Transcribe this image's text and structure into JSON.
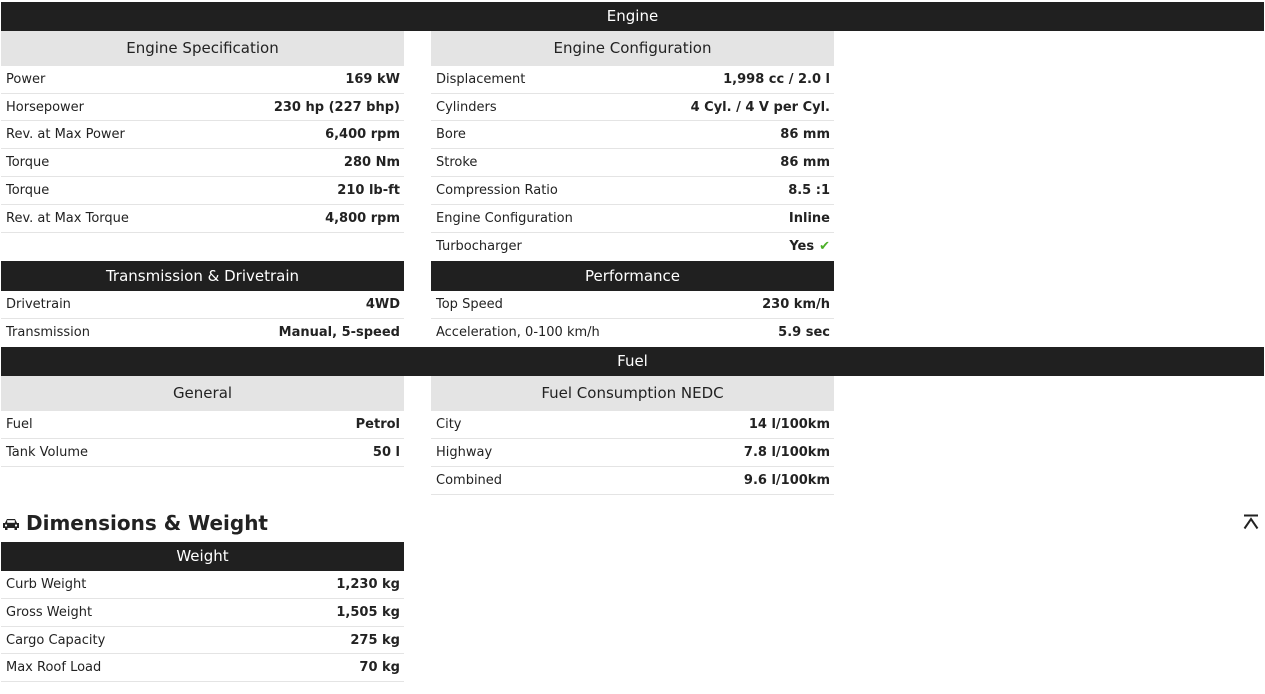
{
  "engine_band": {
    "title": "Engine"
  },
  "engine_spec": {
    "title": "Engine Specification",
    "rows": [
      {
        "label": "Power",
        "value": "169 kW"
      },
      {
        "label": "Horsepower",
        "value": "230 hp (227 bhp)"
      },
      {
        "label": "Rev. at Max Power",
        "value": "6,400 rpm"
      },
      {
        "label": "Torque",
        "value": "280 Nm"
      },
      {
        "label": "Torque",
        "value": "210 lb-ft"
      },
      {
        "label": "Rev. at Max Torque",
        "value": "4,800 rpm"
      }
    ]
  },
  "engine_config": {
    "title": "Engine Configuration",
    "rows": [
      {
        "label": "Displacement",
        "value": "1,998 cc / 2.0 l"
      },
      {
        "label": "Cylinders",
        "value": "4 Cyl. / 4 V per Cyl."
      },
      {
        "label": "Bore",
        "value": "86 mm"
      },
      {
        "label": "Stroke",
        "value": "86 mm"
      },
      {
        "label": "Compression Ratio",
        "value": "8.5 :1"
      },
      {
        "label": "Engine Configuration",
        "value": "Inline"
      },
      {
        "label": "Turbocharger",
        "value": "Yes",
        "icon": "checkmark-icon"
      }
    ]
  },
  "transmission": {
    "title": "Transmission & Drivetrain",
    "rows": [
      {
        "label": "Drivetrain",
        "value": "4WD"
      },
      {
        "label": "Transmission",
        "value": "Manual, 5-speed"
      }
    ]
  },
  "performance": {
    "title": "Performance",
    "rows": [
      {
        "label": "Top Speed",
        "value": "230 km/h"
      },
      {
        "label": "Acceleration, 0-100 km/h",
        "value": "5.9 sec"
      }
    ]
  },
  "fuel_band": {
    "title": "Fuel"
  },
  "general": {
    "title": "General",
    "rows": [
      {
        "label": "Fuel",
        "value": "Petrol"
      },
      {
        "label": "Tank Volume",
        "value": "50 l"
      }
    ]
  },
  "consumption": {
    "title": "Fuel Consumption NEDC",
    "rows": [
      {
        "label": "City",
        "value": "14 l/100km"
      },
      {
        "label": "Highway",
        "value": "7.8 l/100km"
      },
      {
        "label": "Combined",
        "value": "9.6 l/100km"
      }
    ]
  },
  "dimensions": {
    "title": "Dimensions & Weight",
    "icon": "car-icon",
    "back_to_top_icon": "back-to-top-icon"
  },
  "weight": {
    "title": "Weight",
    "rows": [
      {
        "label": "Curb Weight",
        "value": "1,230 kg"
      },
      {
        "label": "Gross Weight",
        "value": "1,505 kg"
      },
      {
        "label": "Cargo Capacity",
        "value": "275 kg"
      },
      {
        "label": "Max Roof Load",
        "value": "70 kg"
      }
    ]
  },
  "colors": {
    "dark": "#202020",
    "light": "#e4e4e4",
    "check": "#4caf28"
  }
}
